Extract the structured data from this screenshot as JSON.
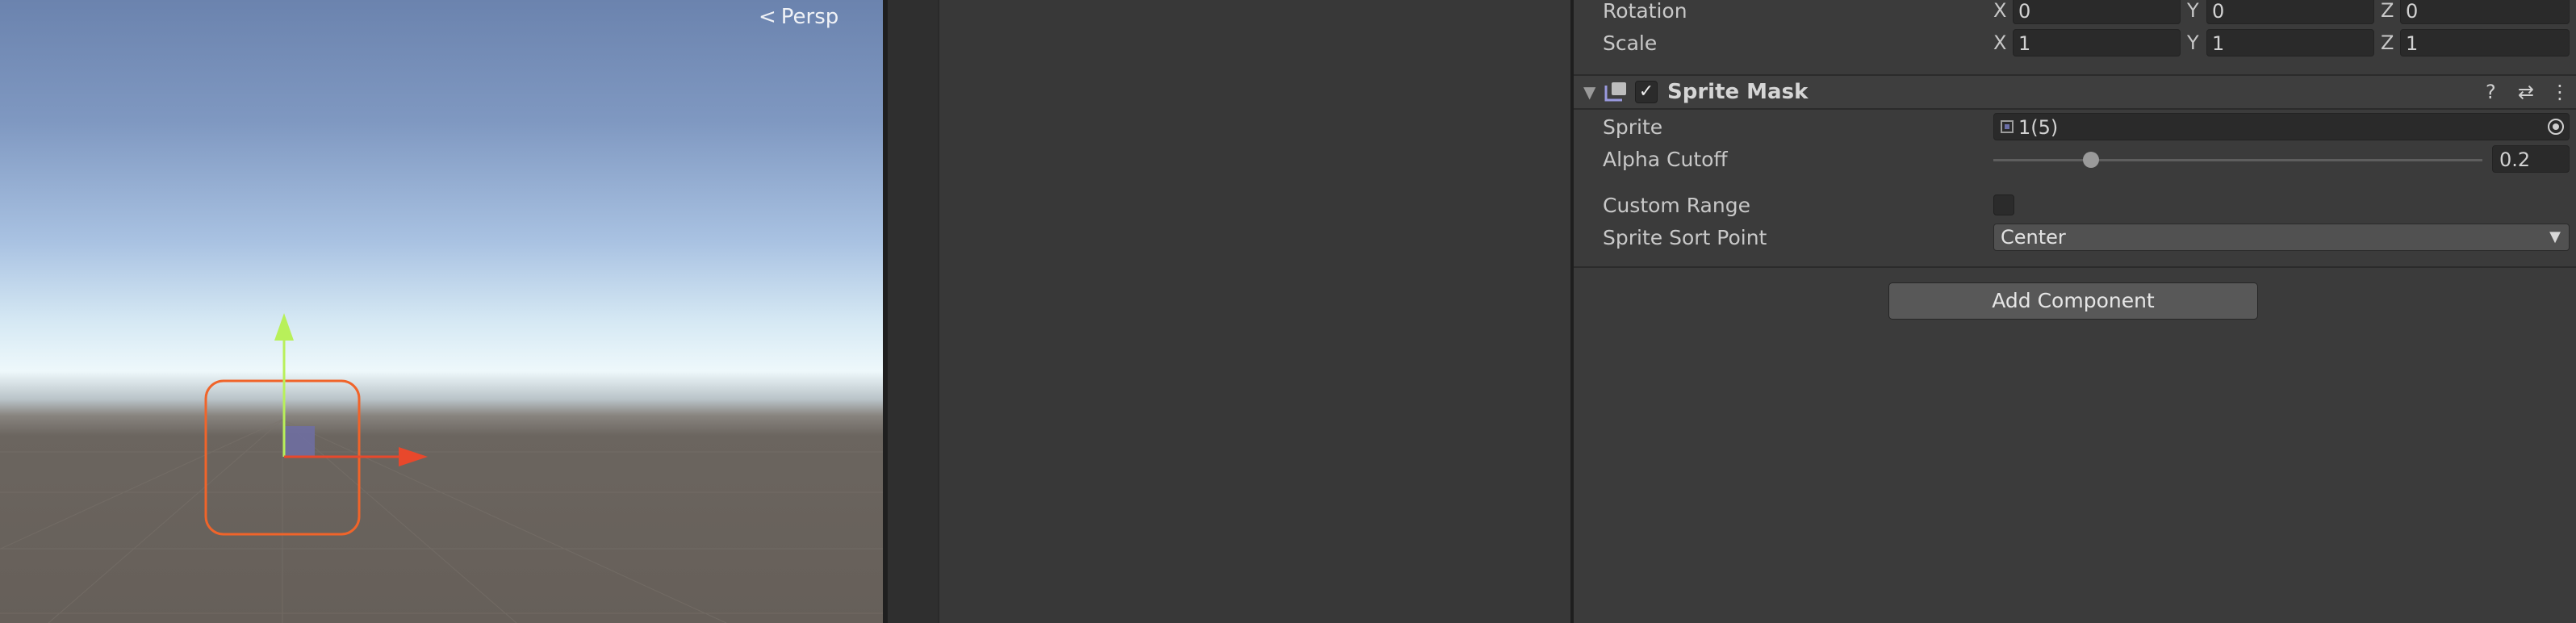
{
  "scene": {
    "projection_label": "Persp",
    "projection_icon": "perspective-icon"
  },
  "inspector": {
    "transform": {
      "rotation": {
        "label": "Rotation",
        "x_axis": "X",
        "x": "0",
        "y_axis": "Y",
        "y": "0",
        "z_axis": "Z",
        "z": "0"
      },
      "scale": {
        "label": "Scale",
        "x_axis": "X",
        "x": "1",
        "y_axis": "Y",
        "y": "1",
        "z_axis": "Z",
        "z": "1"
      }
    },
    "sprite_mask": {
      "title": "Sprite Mask",
      "enabled": true,
      "enabled_glyph": "✓",
      "foldout_glyph": "▼",
      "help_glyph": "?",
      "preset_glyph": "⇄",
      "menu_glyph": "⋮",
      "sprite": {
        "label": "Sprite",
        "value": "1(5)"
      },
      "alpha_cutoff": {
        "label": "Alpha Cutoff",
        "value": "0.2",
        "fraction": 0.2
      },
      "custom_range": {
        "label": "Custom Range",
        "checked": false
      },
      "sprite_sort_point": {
        "label": "Sprite Sort Point",
        "value": "Center",
        "arrow": "▼"
      }
    },
    "add_component_label": "Add Component"
  },
  "colors": {
    "selection_outline": "#f0642a",
    "gizmo_y": "#b8f05a",
    "gizmo_x": "#e8482c"
  }
}
